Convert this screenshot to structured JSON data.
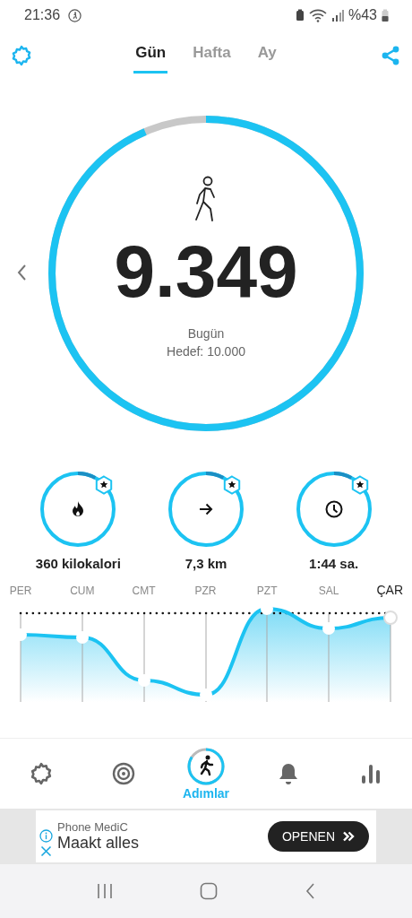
{
  "status_bar": {
    "time": "21:36",
    "battery": "%43"
  },
  "tabs": [
    {
      "label": "Gün",
      "selected": true
    },
    {
      "label": "Hafta",
      "selected": false
    },
    {
      "label": "Ay",
      "selected": false
    }
  ],
  "steps": {
    "value": "9.349",
    "caption": "Bugün",
    "goal": "Hedef: 10.000"
  },
  "stats": [
    {
      "kind": "calories",
      "text": "360 kilokalori"
    },
    {
      "kind": "distance",
      "text": "7,3 km"
    },
    {
      "kind": "time",
      "text": "1:44 sa."
    }
  ],
  "days": [
    {
      "label": "PER",
      "selected": false
    },
    {
      "label": "CUM",
      "selected": false
    },
    {
      "label": "CMT",
      "selected": false
    },
    {
      "label": "PZR",
      "selected": false
    },
    {
      "label": "PZT",
      "selected": false
    },
    {
      "label": "SAL",
      "selected": false
    },
    {
      "label": "ÇAR",
      "selected": true
    }
  ],
  "nav": [
    {
      "kind": "settings",
      "selected": false
    },
    {
      "kind": "target",
      "selected": false
    },
    {
      "kind": "steps",
      "label": "Adımlar",
      "selected": true
    },
    {
      "kind": "bell",
      "selected": false
    },
    {
      "kind": "stats",
      "selected": false
    }
  ],
  "ad": {
    "advertiser": "Phone MediC",
    "headline": "Maakt alles",
    "button": "OPENEN"
  }
}
